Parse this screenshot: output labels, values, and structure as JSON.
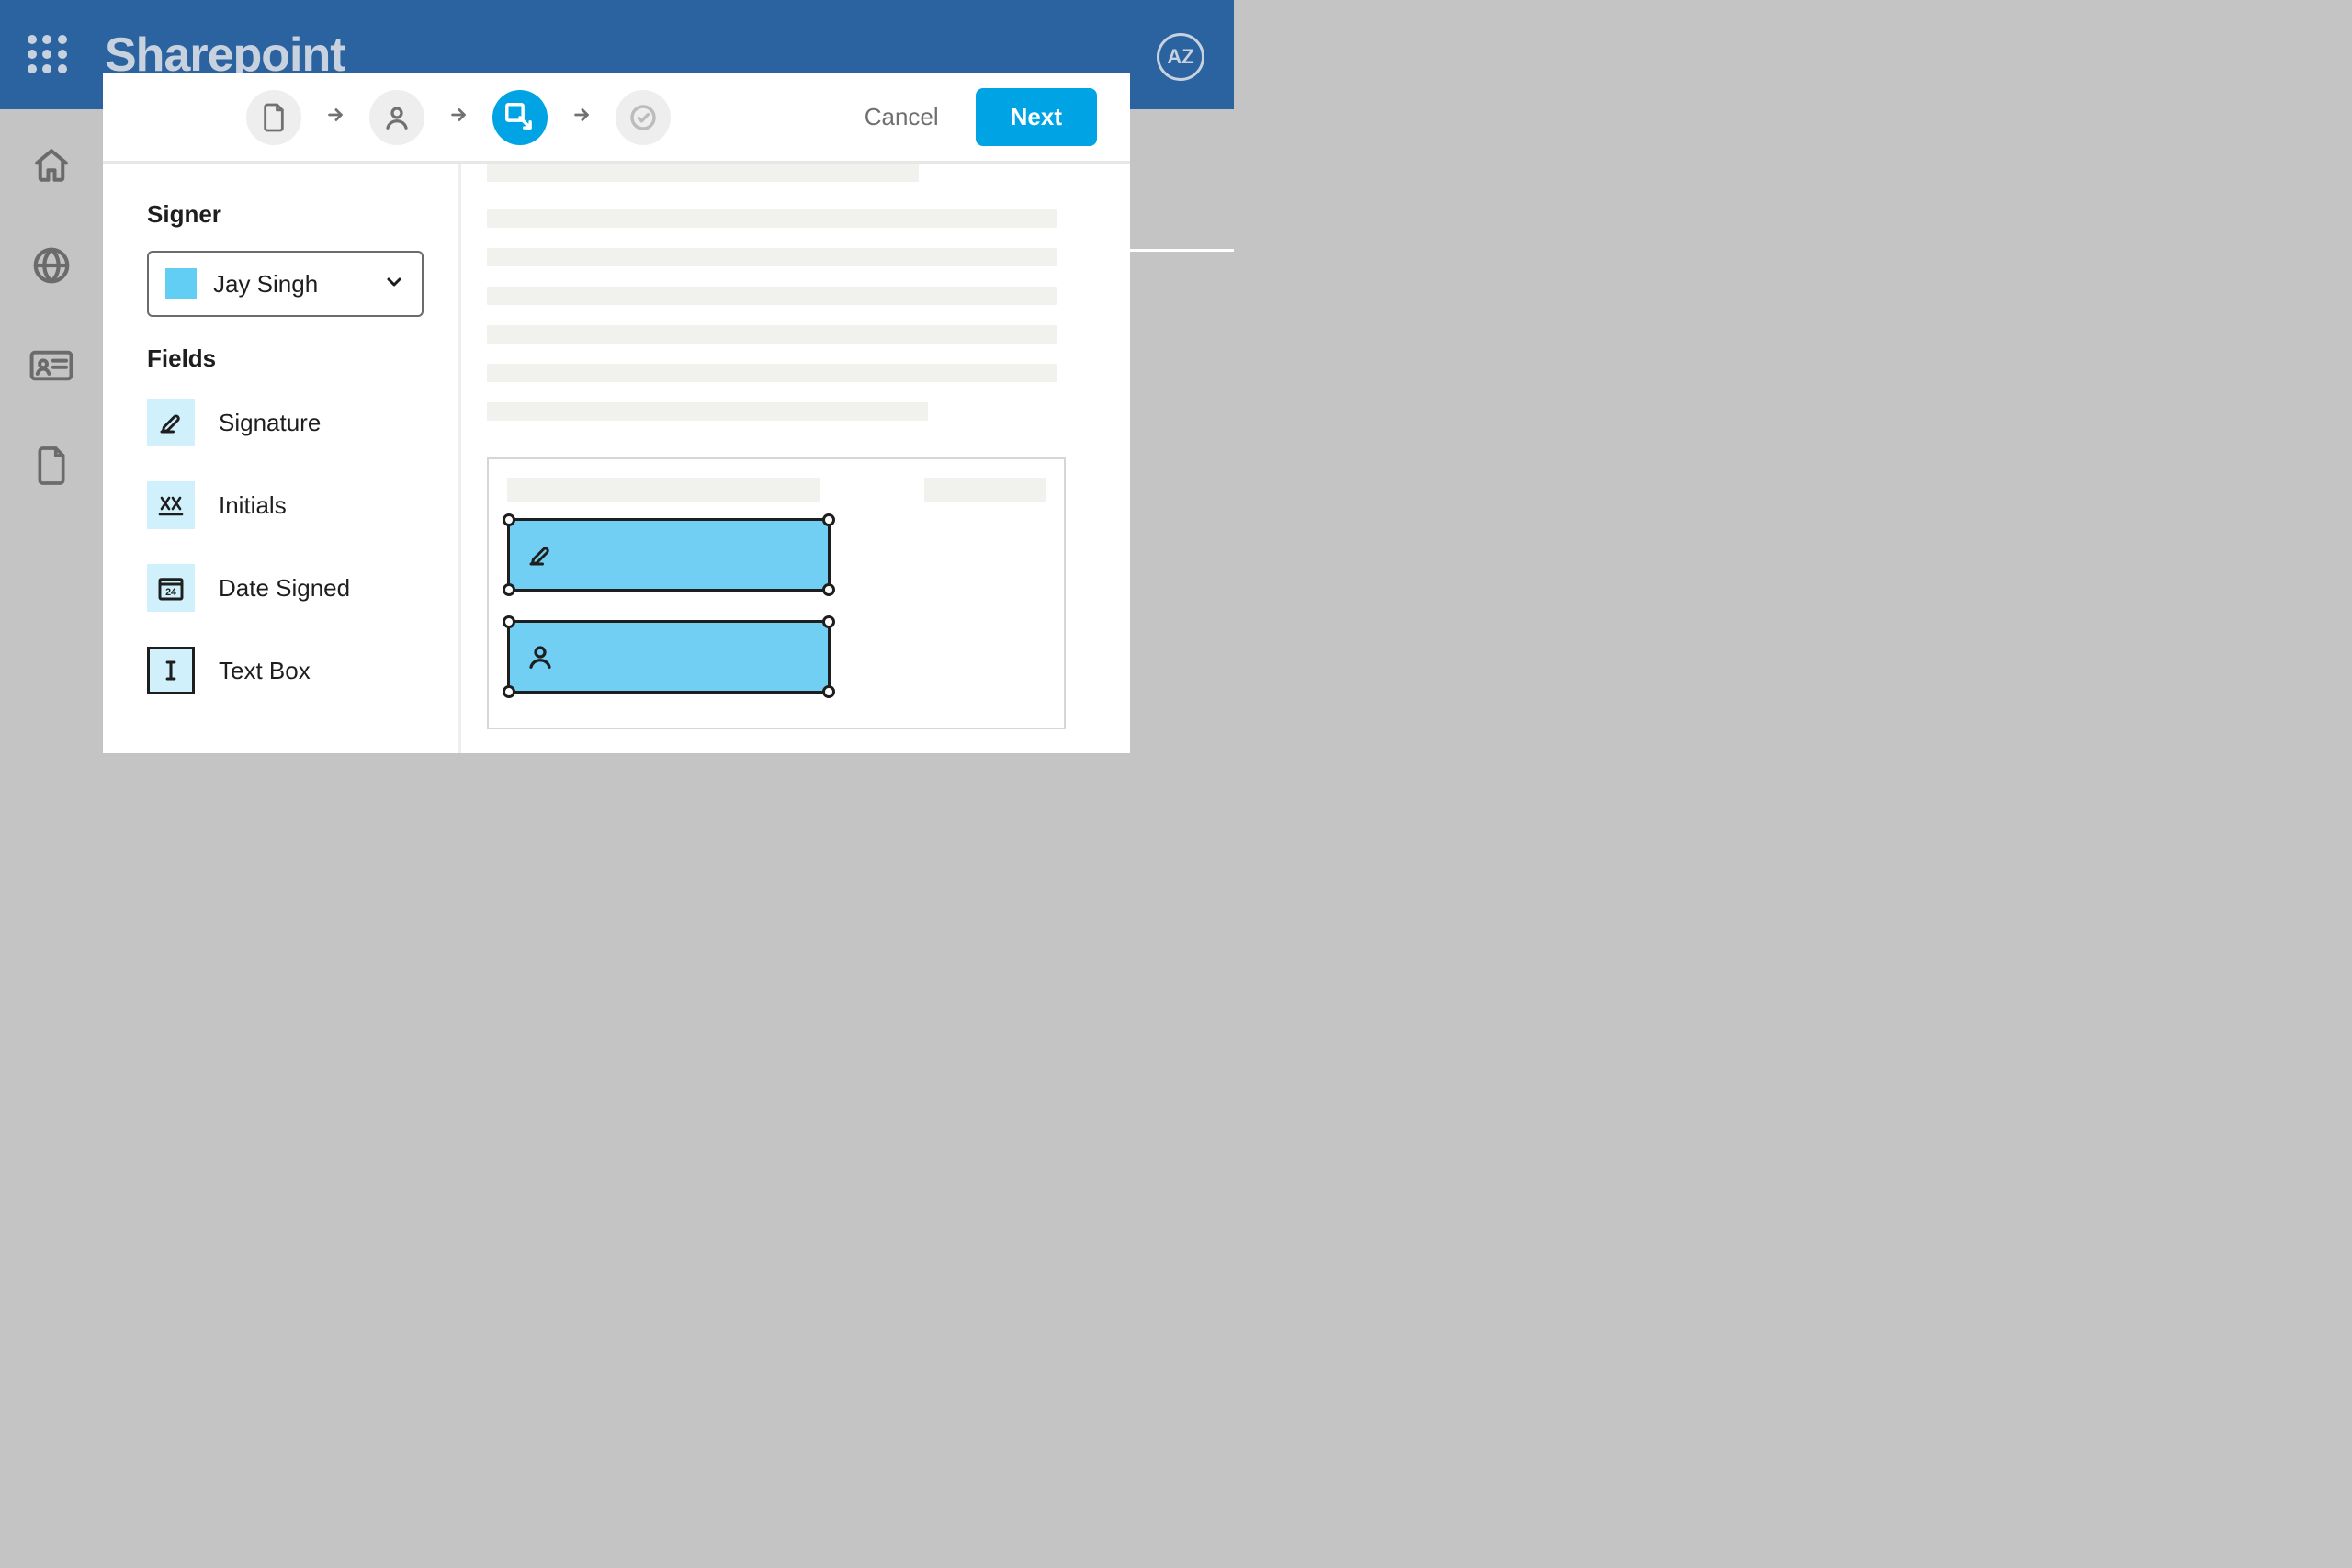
{
  "header": {
    "brand": "Sharepoint",
    "avatar_initials": "AZ"
  },
  "modal": {
    "cancel_label": "Cancel",
    "next_label": "Next"
  },
  "panel": {
    "signer_title": "Signer",
    "signer_selected": "Jay Singh",
    "fields_title": "Fields",
    "fields": [
      {
        "label": "Signature"
      },
      {
        "label": "Initials"
      },
      {
        "label": "Date Signed"
      },
      {
        "label": "Text Box"
      }
    ]
  }
}
